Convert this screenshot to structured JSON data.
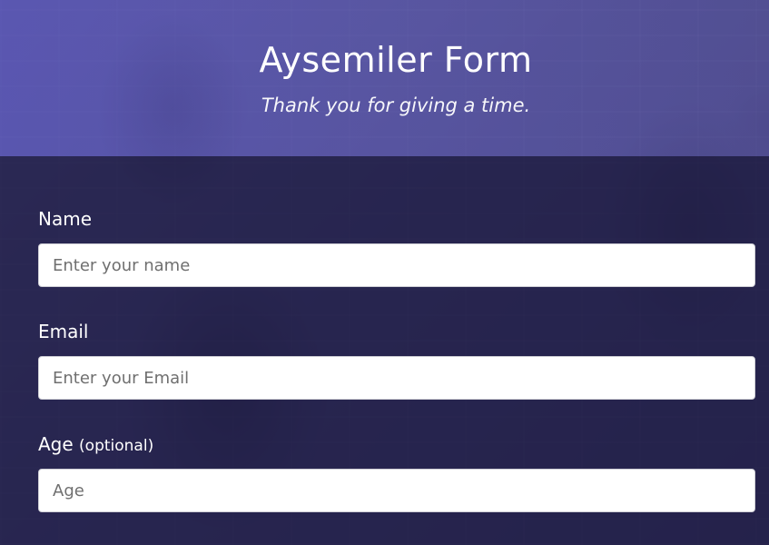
{
  "header": {
    "title": "Aysemiler Form",
    "subtitle": "Thank you for giving a time."
  },
  "form": {
    "name": {
      "label": "Name",
      "placeholder": "Enter your name",
      "value": ""
    },
    "email": {
      "label": "Email",
      "placeholder": "Enter your Email",
      "value": ""
    },
    "age": {
      "label": "Age",
      "optional_label": "(optional)",
      "placeholder": "Age",
      "value": ""
    }
  },
  "colors": {
    "header_overlay": "#6a66c6",
    "form_overlay": "#22204a",
    "text": "#ffffff",
    "input_bg": "#ffffff",
    "placeholder": "#6f6f6f"
  }
}
